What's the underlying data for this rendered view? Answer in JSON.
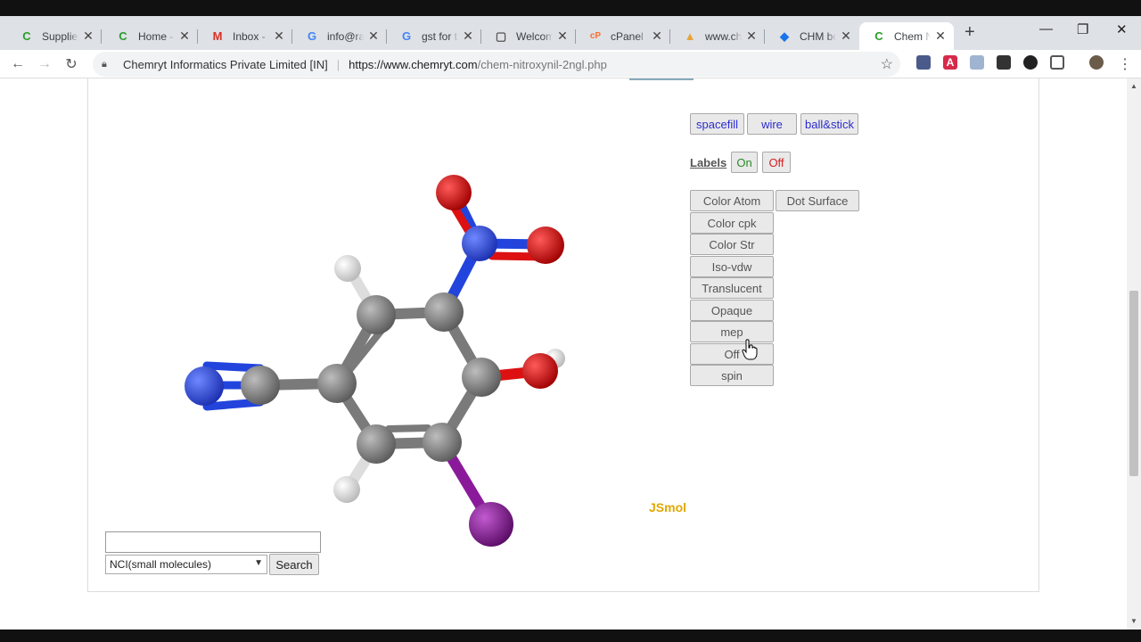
{
  "tabs": [
    {
      "title": "Suppliers",
      "icon": "chemryt-icon",
      "icon_char": "C",
      "icon_color": "#2a9d2a"
    },
    {
      "title": "Home - C",
      "icon": "chemryt-icon",
      "icon_char": "C",
      "icon_color": "#2a9d2a"
    },
    {
      "title": "Inbox - r",
      "icon": "gmail-icon",
      "icon_char": "M",
      "icon_color": "#d93025"
    },
    {
      "title": "info@rad",
      "icon": "google-icon",
      "icon_char": "G",
      "icon_color": "#4285f4"
    },
    {
      "title": "gst for ti",
      "icon": "google-icon",
      "icon_char": "G",
      "icon_color": "#4285f4"
    },
    {
      "title": "Welcome",
      "icon": "document-icon",
      "icon_char": "▢",
      "icon_color": "#555555"
    },
    {
      "title": "cPanel - I",
      "icon": "cpanel-icon",
      "icon_char": "cP",
      "icon_color": "#ff6c2c"
    },
    {
      "title": "www.che",
      "icon": "mpa-icon",
      "icon_char": "▲",
      "icon_color": "#e8a33a"
    },
    {
      "title": "CHM bo",
      "icon": "diamond-icon",
      "icon_char": "◆",
      "icon_color": "#1a73e8"
    },
    {
      "title": "Chem Ni",
      "icon": "chemryt-icon",
      "icon_char": "C",
      "icon_color": "#2a9d2a"
    }
  ],
  "address": {
    "site_name": "Chemryt Informatics Private Limited [IN]",
    "url_host": "https://www.chemryt.com",
    "url_path": "/chem-nitroxynil-2ngl.php"
  },
  "controls": {
    "style_buttons": [
      "spacefill",
      "wire",
      "ball&stick"
    ],
    "labels_title": "Labels",
    "labels_on": "On",
    "labels_off": "Off",
    "color_atom": "Color Atom",
    "dot_surface": "Dot Surface",
    "color_cpk": "Color cpk",
    "color_str": "Color Str",
    "iso_vdw": "Iso-vdw",
    "translucent": "Translucent",
    "opaque": "Opaque",
    "mep": "mep",
    "off": "Off",
    "spin": "spin"
  },
  "viewer": {
    "brand": "JSmol"
  },
  "search": {
    "input_value": "",
    "select_value": "NCI(small molecules)",
    "button": "Search"
  },
  "colors": {
    "carbon": "#7a7a7a",
    "nitrogen": "#2244dd",
    "oxygen": "#dd1111",
    "hydrogen": "#f2f2f2",
    "iodine": "#8b1a9b",
    "jsmol_brand": "#e0a800"
  }
}
